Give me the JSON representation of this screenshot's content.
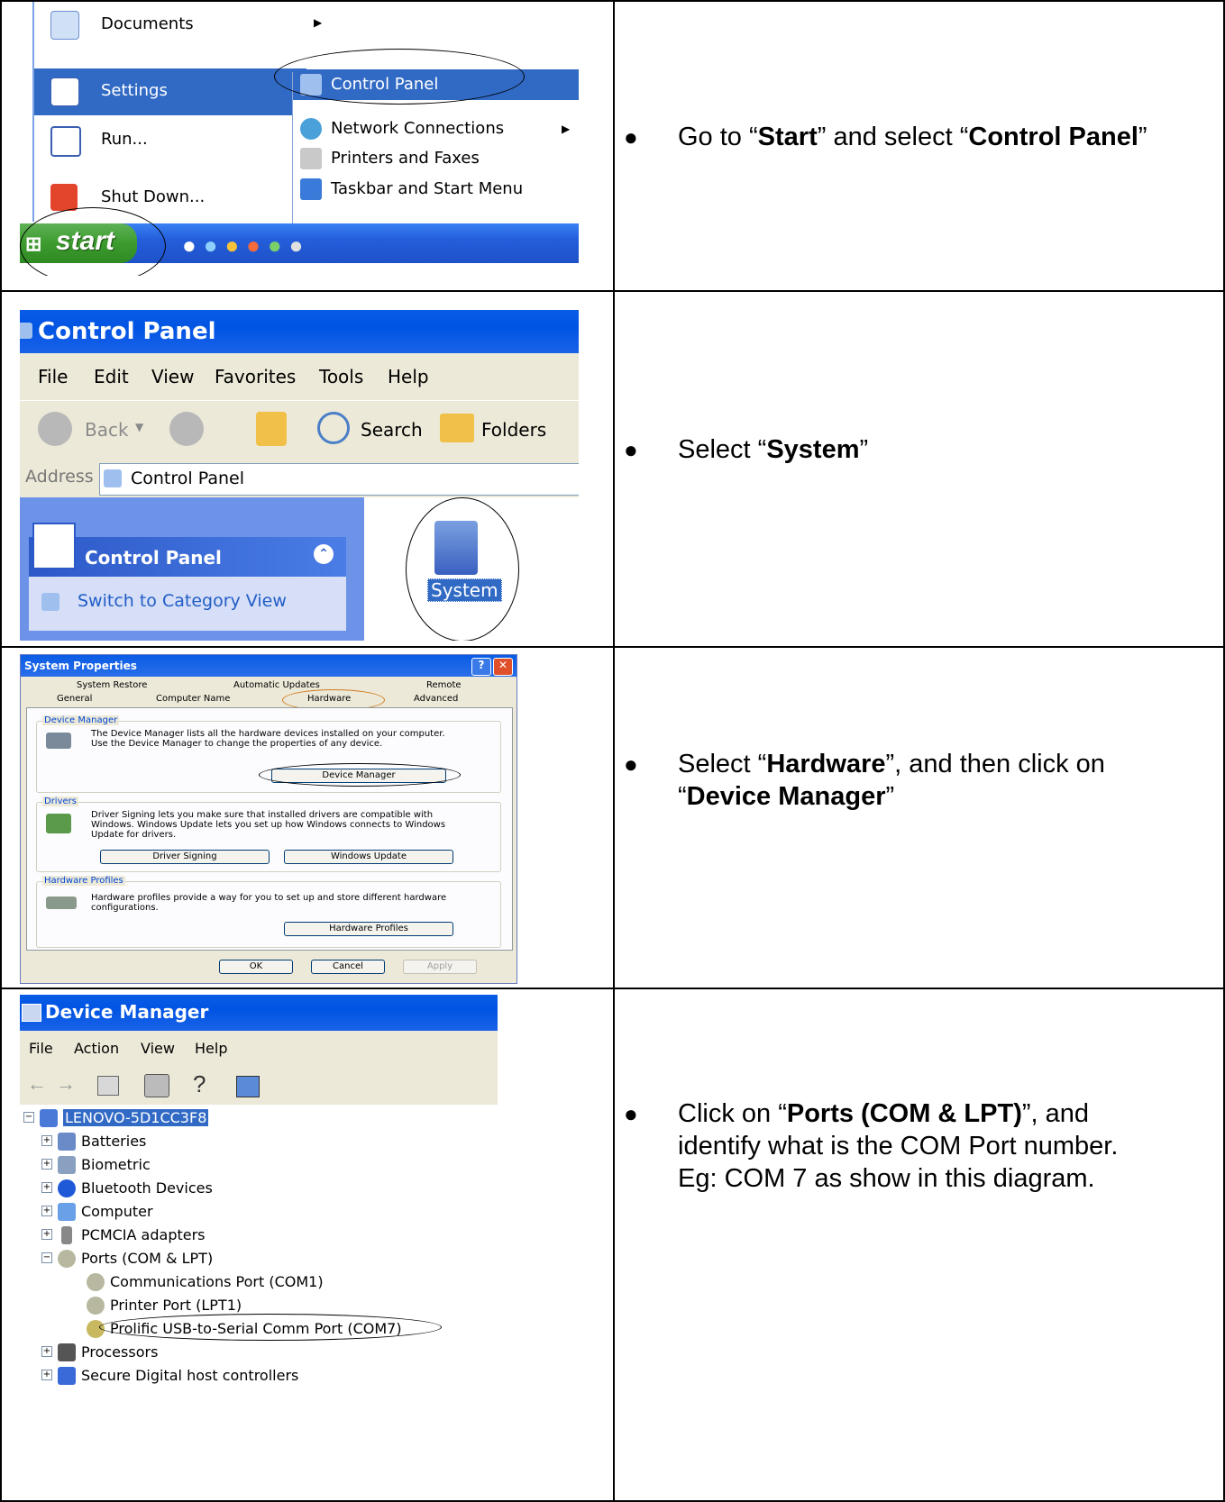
{
  "rows": [
    {
      "instruction": {
        "pre": "Go to “",
        "b1": "Start",
        "mid": "” and select “",
        "b2": "Control Panel",
        "post": "”"
      },
      "screenshot": {
        "left_menu": [
          "Documents",
          "Settings",
          "Run...",
          "Shut Down..."
        ],
        "submenu": [
          "Control Panel",
          "Network Connections",
          "Printers and Faxes",
          "Taskbar and Start Menu"
        ],
        "start_label": "start"
      }
    },
    {
      "instruction": {
        "pre": "Select “",
        "b1": "System",
        "post": "”"
      },
      "screenshot": {
        "title": "Control Panel",
        "menu": [
          "File",
          "Edit",
          "View",
          "Favorites",
          "Tools",
          "Help"
        ],
        "toolbar": {
          "back": "Back",
          "search": "Search",
          "folders": "Folders"
        },
        "address_label": "Address",
        "address_value": "Control Panel",
        "task_header": "Control Panel",
        "task_link": "Switch to Category View",
        "system_icon_label": "System"
      }
    },
    {
      "instruction": {
        "pre": "Select “",
        "b1": "Hardware",
        "mid": "”, and then click on",
        "line2_pre": "“",
        "b2": "Device Manager",
        "post": "”"
      },
      "screenshot": {
        "title": "System Properties",
        "tabs_row1": [
          "System Restore",
          "Automatic Updates",
          "Remote"
        ],
        "tabs_row2": [
          "General",
          "Computer Name",
          "Hardware",
          "Advanced"
        ],
        "groups": {
          "device_manager": {
            "title": "Device Manager",
            "text": "The Device Manager lists all the hardware devices installed on your computer. Use the Device Manager to change the properties of any device.",
            "button": "Device Manager"
          },
          "drivers": {
            "title": "Drivers",
            "text": "Driver Signing lets you make sure that installed drivers are compatible with Windows. Windows Update lets you set up how Windows connects to Windows Update for drivers.",
            "buttons": [
              "Driver Signing",
              "Windows Update"
            ]
          },
          "hardware_profiles": {
            "title": "Hardware Profiles",
            "text": "Hardware profiles provide a way for you to set up and store different hardware configurations.",
            "button": "Hardware Profiles"
          }
        },
        "footer_buttons": [
          "OK",
          "Cancel",
          "Apply"
        ]
      }
    },
    {
      "instruction": {
        "pre": "Click on “",
        "b1": "Ports (COM & LPT)",
        "mid": "”, and",
        "line2": "identify what is the COM Port number.",
        "line3": "Eg: COM 7 as show in this diagram."
      },
      "screenshot": {
        "title": "Device Manager",
        "menu": [
          "File",
          "Action",
          "View",
          "Help"
        ],
        "tree_root": "LENOVO-5D1CC3F8",
        "tree_items": [
          "Batteries",
          "Biometric",
          "Bluetooth Devices",
          "Computer",
          "PCMCIA adapters",
          "Ports (COM & LPT)"
        ],
        "ports_children": [
          "Communications Port (COM1)",
          "Printer Port (LPT1)",
          "Prolific USB-to-Serial Comm Port (COM7)"
        ],
        "tree_items_after": [
          "Processors",
          "Secure Digital host controllers"
        ]
      }
    }
  ]
}
